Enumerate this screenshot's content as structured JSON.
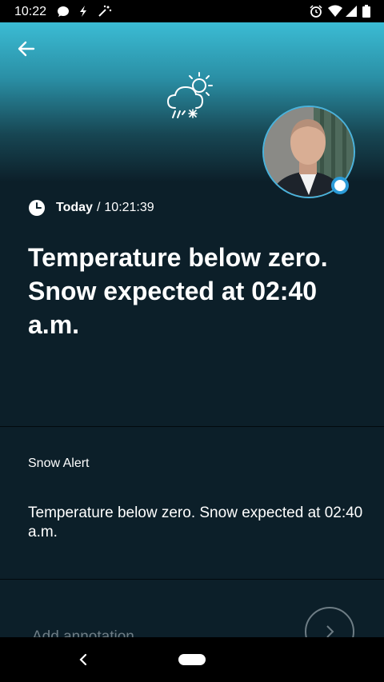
{
  "status_bar": {
    "time": "10:22"
  },
  "alert": {
    "date_label": "Today",
    "date_separator": "/",
    "time": "10:21:39",
    "title": "Temperature below zero. Snow expected at 02:40 a.m.",
    "name": "Snow Alert",
    "description": "Temperature below zero. Snow expected at 02:40 a.m."
  },
  "annotation": {
    "placeholder": "Add annotation"
  },
  "icons": {
    "back": "arrow-left-icon",
    "weather": "snow-cloud-sun-icon",
    "clock": "clock-icon",
    "next": "chevron-right-icon"
  },
  "colors": {
    "background": "#0c1f29",
    "header_top": "#3bbcd4",
    "avatar_ring": "#4ab3dc",
    "muted_text": "#6e7d85"
  }
}
